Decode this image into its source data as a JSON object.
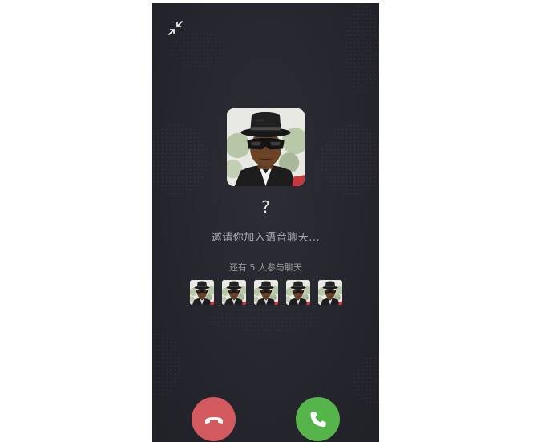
{
  "call": {
    "caller_name": "?",
    "invite_text": "邀请你加入语音聊天...",
    "others_text": "还有 5 人参与聊天"
  },
  "participants": [
    {
      "avatar": "meme-avatar"
    },
    {
      "avatar": "meme-avatar"
    },
    {
      "avatar": "meme-avatar"
    },
    {
      "avatar": "meme-avatar"
    },
    {
      "avatar": "meme-avatar"
    }
  ],
  "buttons": {
    "decline": {
      "icon": "hang-up-icon",
      "color": "#d35a5e"
    },
    "accept": {
      "icon": "phone-icon",
      "color": "#56b54a"
    },
    "minimize": {
      "icon": "minimize-icon"
    }
  },
  "colors": {
    "background": "#26262e",
    "decline": "#d35a5e",
    "accept": "#56b54a"
  }
}
